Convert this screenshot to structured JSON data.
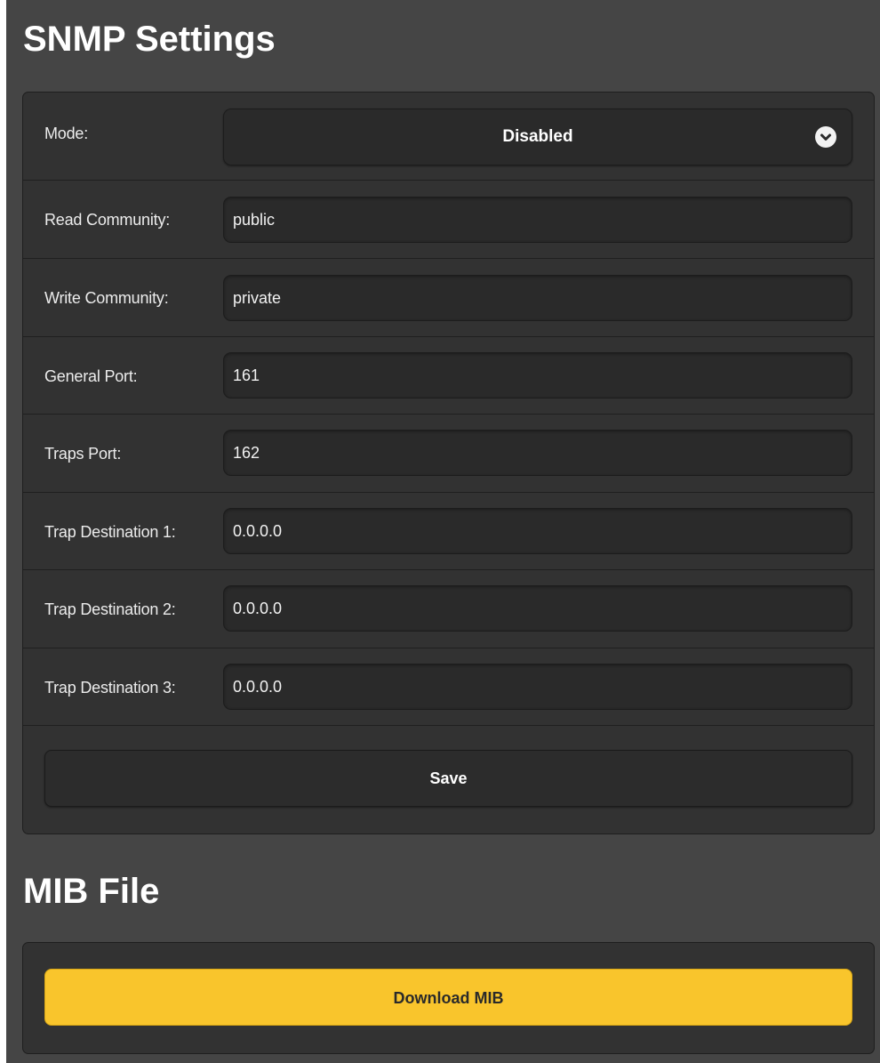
{
  "snmp": {
    "title": "SNMP Settings",
    "mode": {
      "label": "Mode:",
      "value": "Disabled"
    },
    "read_community": {
      "label": "Read Community:",
      "value": "public"
    },
    "write_community": {
      "label": "Write Community:",
      "value": "private"
    },
    "general_port": {
      "label": "General Port:",
      "value": "161"
    },
    "traps_port": {
      "label": "Traps Port:",
      "value": "162"
    },
    "trap_destination_1": {
      "label": "Trap Destination 1:",
      "value": "0.0.0.0"
    },
    "trap_destination_2": {
      "label": "Trap Destination 2:",
      "value": "0.0.0.0"
    },
    "trap_destination_3": {
      "label": "Trap Destination 3:",
      "value": "0.0.0.0"
    },
    "save_label": "Save"
  },
  "mib": {
    "title": "MIB File",
    "download_label": "Download MIB"
  },
  "icons": {
    "mode_dropdown": "chevron-down-icon"
  },
  "colors": {
    "background": "#454545",
    "panel": "#323232",
    "field": "#2a2a2a",
    "accent": "#f9c52c"
  }
}
